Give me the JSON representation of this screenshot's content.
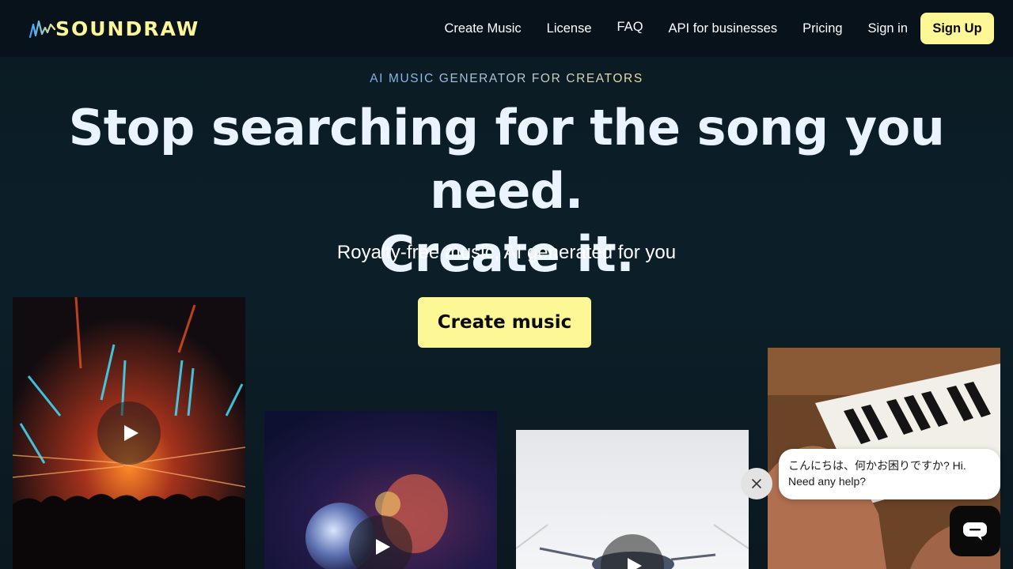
{
  "brand": {
    "name": "SOUNDRAW"
  },
  "nav": {
    "items": [
      "Create Music",
      "License",
      "FAQ",
      "API for businesses",
      "Pricing",
      "Sign in"
    ],
    "signup_label": "Sign Up"
  },
  "hero": {
    "eyebrow": "AI MUSIC GENERATOR FOR CREATORS",
    "headline_line1": "Stop searching for the song you need.",
    "headline_line2": "Create it.",
    "subline": "Royalty-free music, AI generated for you",
    "cta_label": "Create music"
  },
  "cards": [
    {
      "icon": "play-icon",
      "scene": "concert-lights"
    },
    {
      "icon": "play-icon",
      "scene": "disco-ball"
    },
    {
      "icon": "play-icon",
      "scene": "white-studio"
    },
    {
      "icon": "none",
      "scene": "piano-keys"
    }
  ],
  "chat": {
    "message_line1": "こんにちは、何かお困りですか? Hi.",
    "message_line2": "Need any help?",
    "close_icon": "close-icon",
    "launcher_icon": "chat-icon"
  },
  "colors": {
    "accent_yellow": "#fdf795",
    "header_bg": "#07121a",
    "page_bg": "#0c1f29",
    "headline_text": "#eaf4ff"
  }
}
